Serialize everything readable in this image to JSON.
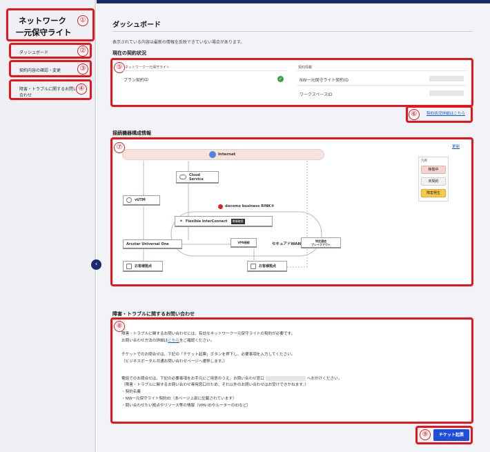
{
  "sidebar": {
    "brand_line1": "ネットワーク",
    "brand_line2": "一元保守ライト",
    "items": [
      {
        "label": "ダッシュボード"
      },
      {
        "label": "契約内容の確認・変更"
      },
      {
        "label": "障害・トラブルに関するお問い合わせ"
      }
    ]
  },
  "main": {
    "title": "ダッシュボード",
    "notice": "表示されている内容は最新の情報を反映できていない場合があります。",
    "contract": {
      "heading": "現在の契約状況",
      "col_left": "ネットワーク一元保守ライト",
      "col_right": "契約情報",
      "plan_label": "プラン契約中",
      "row1_label": "NW一元保守ライト契約ID",
      "row2_label": "ワークスペースID",
      "detail_link": "契約状況詳細はこちら"
    },
    "topology": {
      "heading": "接続機器構成情報",
      "update_link": "更新",
      "internet": "Internet",
      "cloud_line1": "Cloud",
      "cloud_line2": "Service",
      "vutm": "vUTM",
      "rink": "docomo business RINK®",
      "fic": "Flexible InterConnect",
      "fic_badge": "帯域確保",
      "arcstar": "Arcstar Universal One",
      "vpn": "VPN接続",
      "secure_wan": "セキュアドWAN",
      "breakout_line1": "特定通信",
      "breakout_line2": "ブレイクアウト",
      "site_left": "お客様拠点",
      "site_right": "お客様拠点",
      "legend_title": "凡例",
      "legend": [
        "稼働中",
        "未契約",
        "障害発生"
      ],
      "legend_colors": [
        "#f4d4d0",
        "#f1f1f1",
        "#f7c94a"
      ]
    },
    "inquiry": {
      "heading": "障害・トラブルに関するお問い合わせ",
      "p1a": "障害・トラブルに関するお問い合わせには、有効なネットワーク一元保守ライトの契約が必要です。",
      "p1b_pre": "お問い合わせ方法の詳細は",
      "p1b_link": "こちら",
      "p1b_post": "をご確認ください。",
      "p2a": "チケットでのお問合せは、下記の「チケット起票」ボタンを押下し、必要事項を入力してください。",
      "p2b": "（ビジネスポータル共通お問い合わせページへ遷移します。）",
      "p3a_pre": "電話でのお問合せは、下記の必要事項をお手元にご用意のうえ、お問い合わせ窓口",
      "p3a_post": "へおかけください。",
      "p3b": "（障害・トラブルに関するお問い合わせ専用窓口のため、それ以外のお問い合わせはお受けできかねます。）",
      "b1": "・契約名義",
      "b2": "・NW一元保守ライト契約ID（本ページ上部に記載されています）",
      "b3": "・問い合わせたい拠点やリソース等の情報（VPN IDやルーターのIDなど）",
      "ticket_button": "チケット起票"
    }
  },
  "annotations": [
    "①",
    "②",
    "③",
    "④",
    "⑤",
    "⑥",
    "⑦",
    "⑧",
    "⑨"
  ],
  "colors": {
    "annotation": "#e8141c",
    "navy": "#1c2a6b",
    "button": "#1f4fd8",
    "link": "#1a56c8"
  }
}
